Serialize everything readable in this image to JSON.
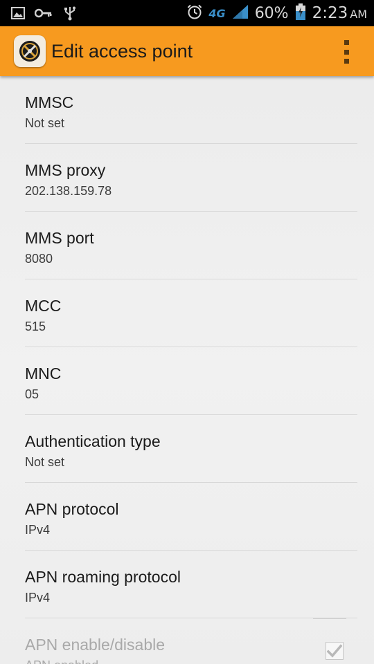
{
  "status_bar": {
    "network_type": "4G",
    "battery_percent": "60%",
    "time": "2:23",
    "ampm": "AM",
    "icons": [
      "image-icon",
      "key-icon",
      "usb-icon",
      "alarm-icon",
      "signal-icon",
      "battery-icon"
    ]
  },
  "action_bar": {
    "title": "Edit access point",
    "background_color": "#f79a1f",
    "menu_icon": "overflow-menu-icon"
  },
  "prefs": [
    {
      "title": "MMSC",
      "summary": "Not set"
    },
    {
      "title": "MMS proxy",
      "summary": "202.138.159.78"
    },
    {
      "title": "MMS port",
      "summary": "8080"
    },
    {
      "title": "MCC",
      "summary": "515"
    },
    {
      "title": "MNC",
      "summary": "05"
    },
    {
      "title": "Authentication type",
      "summary": "Not set"
    },
    {
      "title": "APN protocol",
      "summary": "IPv4"
    },
    {
      "title": "APN roaming protocol",
      "summary": "IPv4"
    },
    {
      "title": "APN enable/disable",
      "summary": "APN enabled",
      "checked": true,
      "enabled": false
    }
  ]
}
